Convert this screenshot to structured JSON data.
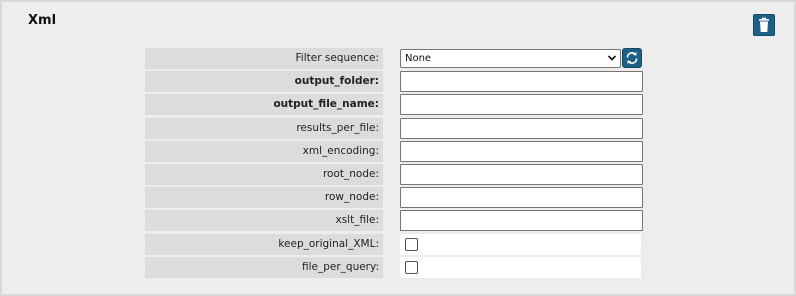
{
  "panel": {
    "title": "Xml",
    "delete_icon": "trash-icon",
    "accent_color": "#1d5f86"
  },
  "form": {
    "filter_sequence": {
      "label": "Filter sequence:",
      "selected": "None",
      "refresh_icon": "refresh-icon"
    },
    "fields": [
      {
        "label": "output_folder:",
        "bold": true,
        "value": ""
      },
      {
        "label": "output_file_name:",
        "bold": true,
        "value": ""
      },
      {
        "label": "results_per_file:",
        "bold": false,
        "value": ""
      },
      {
        "label": "xml_encoding:",
        "bold": false,
        "value": ""
      },
      {
        "label": "root_node:",
        "bold": false,
        "value": ""
      },
      {
        "label": "row_node:",
        "bold": false,
        "value": ""
      },
      {
        "label": "xslt_file:",
        "bold": false,
        "value": ""
      }
    ],
    "checkboxes": [
      {
        "label": "keep_original_XML:",
        "checked": false
      },
      {
        "label": "file_per_query:",
        "checked": false
      }
    ]
  }
}
